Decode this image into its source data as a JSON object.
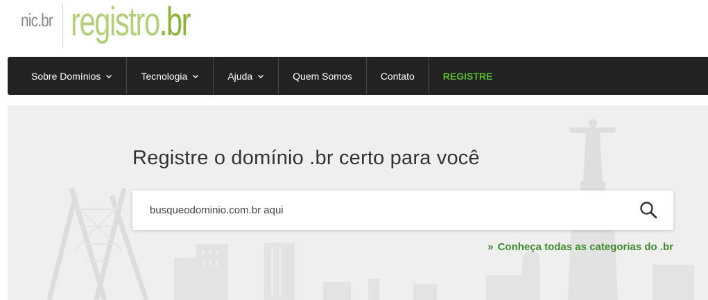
{
  "logo": {
    "nic": "nic.br",
    "registro": "registro",
    "tld": ".br"
  },
  "nav": {
    "items": [
      {
        "label": "Sobre Domínios",
        "dropdown": true
      },
      {
        "label": "Tecnologia",
        "dropdown": true
      },
      {
        "label": "Ajuda",
        "dropdown": true
      },
      {
        "label": "Quem Somos",
        "dropdown": false
      },
      {
        "label": "Contato",
        "dropdown": false
      },
      {
        "label": "REGISTRE",
        "dropdown": false
      }
    ]
  },
  "hero": {
    "title": "Registre o domínio .br certo para você",
    "search": {
      "placeholder": "busqueodominio.com.br aqui",
      "value": ""
    },
    "search_icon": "search-icon",
    "categories_link": {
      "prefix": "»",
      "label": "Conheça todas as categorias do .br"
    }
  },
  "colors": {
    "nav_bg": "#222222",
    "registre": "#5cb531",
    "link": "#3f8a2c",
    "logo_light": "#b3cf7a",
    "logo_dark": "#8db33a"
  }
}
